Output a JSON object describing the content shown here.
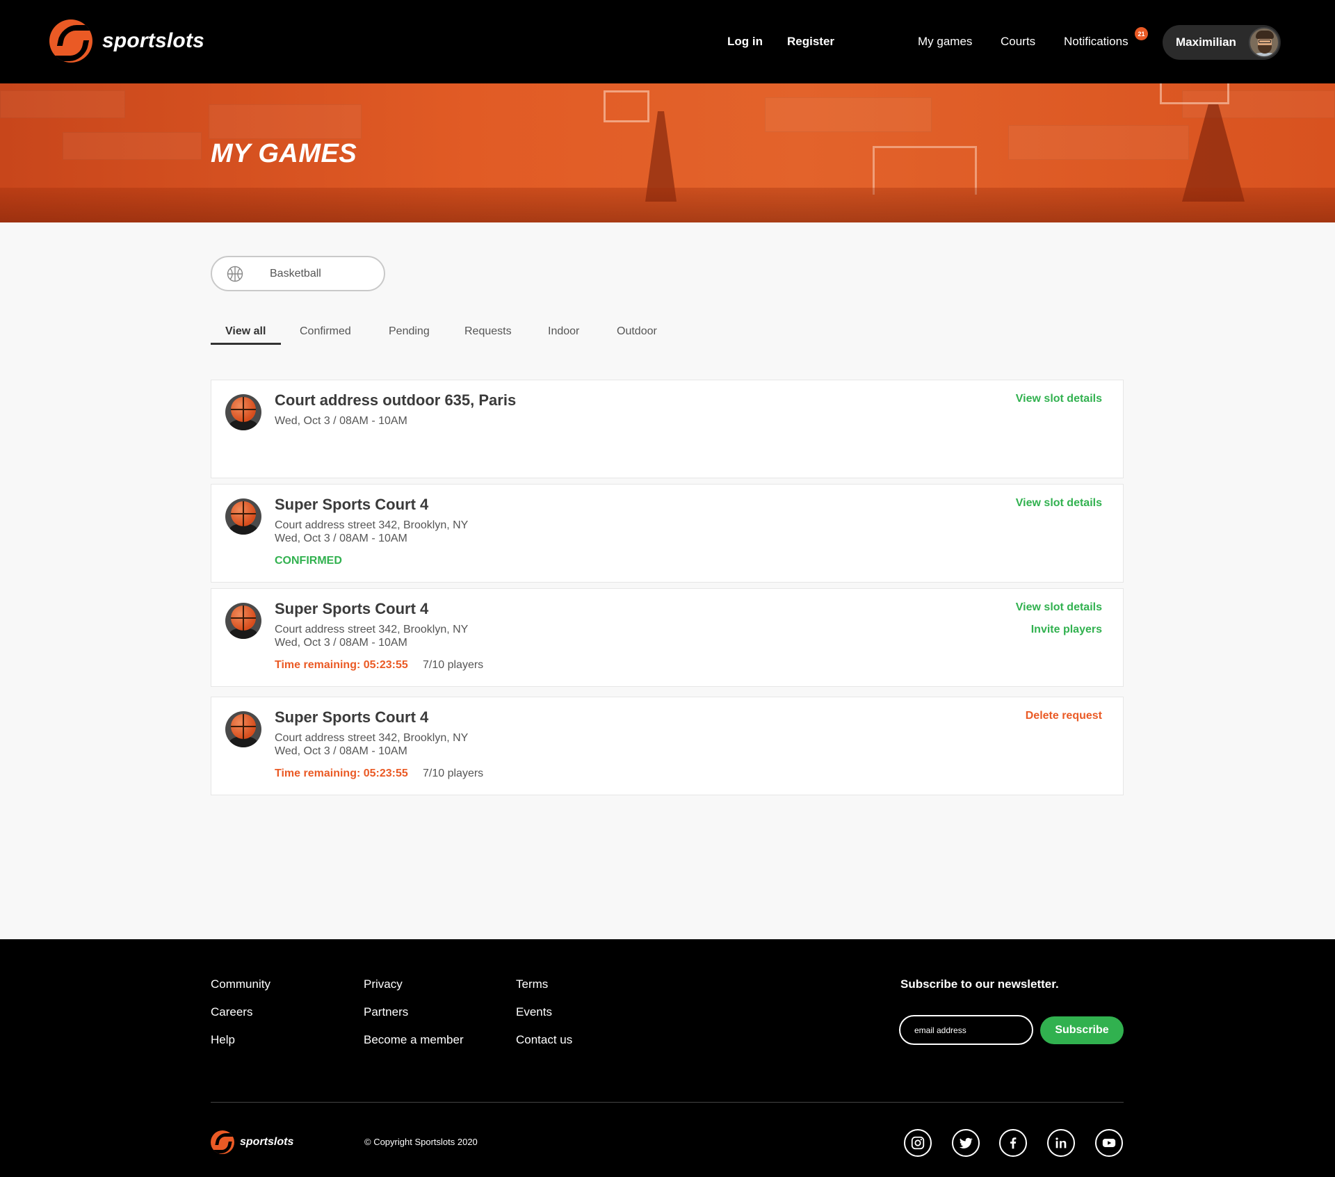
{
  "brand": {
    "name": "sportslots",
    "accent": "#ea5a25",
    "success": "#31b14f"
  },
  "nav": {
    "login": "Log in",
    "register": "Register",
    "my_games": "My games",
    "courts": "Courts",
    "notifications": "Notifications",
    "notification_count": "21",
    "user_name": "Maximilian"
  },
  "page": {
    "title": "MY GAMES"
  },
  "filter": {
    "sport": "Basketball",
    "tabs": [
      "View all",
      "Confirmed",
      "Pending",
      "Requests",
      "Indoor",
      "Outdoor"
    ],
    "active_tab": "View all"
  },
  "games": [
    {
      "title": "Court address outdoor 635, Paris",
      "datetime": "Wed, Oct 3 / 08AM - 10AM",
      "actions": [
        "View slot details"
      ]
    },
    {
      "title": "Super Sports Court 4",
      "address": "Court address street 342, Brooklyn, NY",
      "datetime": "Wed, Oct 3 / 08AM - 10AM",
      "status": "CONFIRMED",
      "actions": [
        "View slot details"
      ]
    },
    {
      "title": "Super Sports Court 4",
      "address": "Court address street 342, Brooklyn, NY",
      "datetime": "Wed, Oct 3 / 08AM - 10AM",
      "time_remaining": "Time remaining: 05:23:55",
      "players": "7/10 players",
      "actions": [
        "View slot details",
        "Invite players"
      ]
    },
    {
      "title": "Super Sports Court 4",
      "address": "Court address street 342, Brooklyn, NY",
      "datetime": "Wed, Oct 3 / 08AM - 10AM",
      "time_remaining": "Time remaining: 05:23:55",
      "players": "7/10 players",
      "actions": [
        "Delete request"
      ]
    }
  ],
  "footer": {
    "links": {
      "col1": [
        "Community",
        "Careers",
        "Help"
      ],
      "col2": [
        "Privacy",
        "Partners",
        "Become a member"
      ],
      "col3": [
        "Terms",
        "Events",
        "Contact us"
      ]
    },
    "newsletter_title": "Subscribe to our newsletter.",
    "email_placeholder": "email address",
    "subscribe_label": "Subscribe",
    "brand": "sportslots",
    "copyright": "© Copyright Sportslots 2020",
    "social": [
      "instagram-icon",
      "twitter-icon",
      "facebook-icon",
      "linkedin-icon",
      "youtube-icon"
    ]
  }
}
